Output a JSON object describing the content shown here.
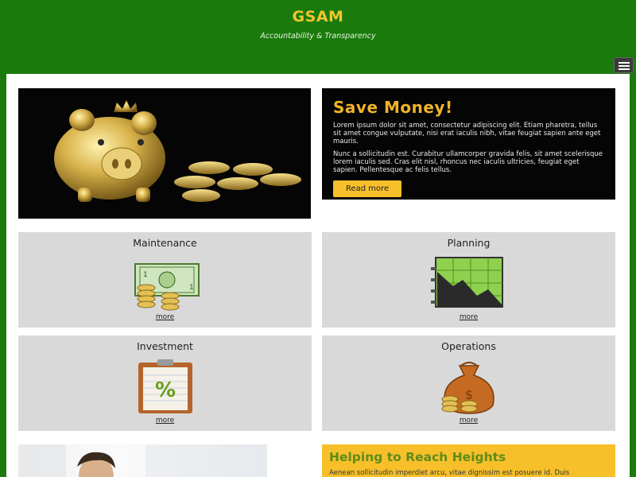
{
  "header": {
    "brand": "GSAM",
    "tagline": "Accountability & Transparency",
    "menu_icon": "hamburger-menu-icon"
  },
  "hero": {
    "image_icon": "piggy-bank-icon",
    "title": "Save Money!",
    "paragraph1": "Lorem ipsum dolor sit amet, consectetur adipiscing elit. Etiam pharetra, tellus sit amet congue vulputate, nisi erat iaculis nibh, vitae feugiat sapien ante eget mauris.",
    "paragraph2": "Nunc a sollicitudin est. Curabitur ullamcorper gravida felis, sit amet scelerisque lorem iaculis sed. Cras elit nisl, rhoncus nec iaculis ultricies, feugiat eget sapien. Pellentesque ac felis tellus.",
    "button_label": "Read more"
  },
  "tiles": [
    {
      "title": "Maintenance",
      "icon": "money-coins-icon",
      "more": "more"
    },
    {
      "title": "Planning",
      "icon": "chart-down-icon",
      "more": "more"
    },
    {
      "title": "Investment",
      "icon": "percent-clipboard-icon",
      "more": "more"
    },
    {
      "title": "Operations",
      "icon": "money-bag-icon",
      "more": "more"
    }
  ],
  "bottom": {
    "image_icon": "businessman-photo-icon",
    "title": "Helping to Reach Heights",
    "text": "Aenean sollicitudin imperdiet arcu, vitae dignissim est posuere id. Duis"
  },
  "colors": {
    "background": "#1a7a0c",
    "accent": "#f7c02a",
    "tile": "#d9d9d9"
  }
}
